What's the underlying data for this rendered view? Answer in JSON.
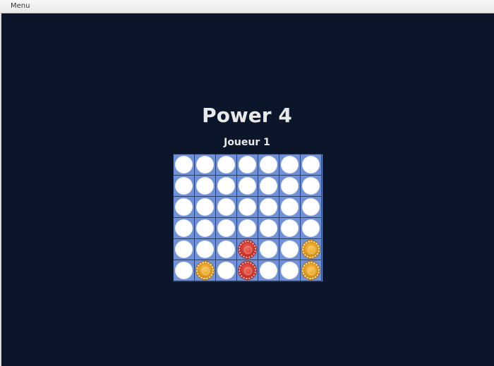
{
  "menubar": {
    "menu_label": "Menu"
  },
  "game": {
    "title": "Power 4",
    "current_player": "Joueur 1",
    "rows": 6,
    "columns": 7,
    "colors": {
      "background": "#0b162b",
      "board": "#6f91da",
      "empty": "#ffffff",
      "red": "#d9473a",
      "yellow": "#e9a82c"
    },
    "grid": [
      [
        "empty",
        "empty",
        "empty",
        "empty",
        "empty",
        "empty",
        "empty"
      ],
      [
        "empty",
        "empty",
        "empty",
        "empty",
        "empty",
        "empty",
        "empty"
      ],
      [
        "empty",
        "empty",
        "empty",
        "empty",
        "empty",
        "empty",
        "empty"
      ],
      [
        "empty",
        "empty",
        "empty",
        "empty",
        "empty",
        "empty",
        "empty"
      ],
      [
        "empty",
        "empty",
        "empty",
        "red",
        "empty",
        "empty",
        "yellow"
      ],
      [
        "empty",
        "yellow",
        "empty",
        "red",
        "empty",
        "empty",
        "yellow"
      ]
    ]
  }
}
